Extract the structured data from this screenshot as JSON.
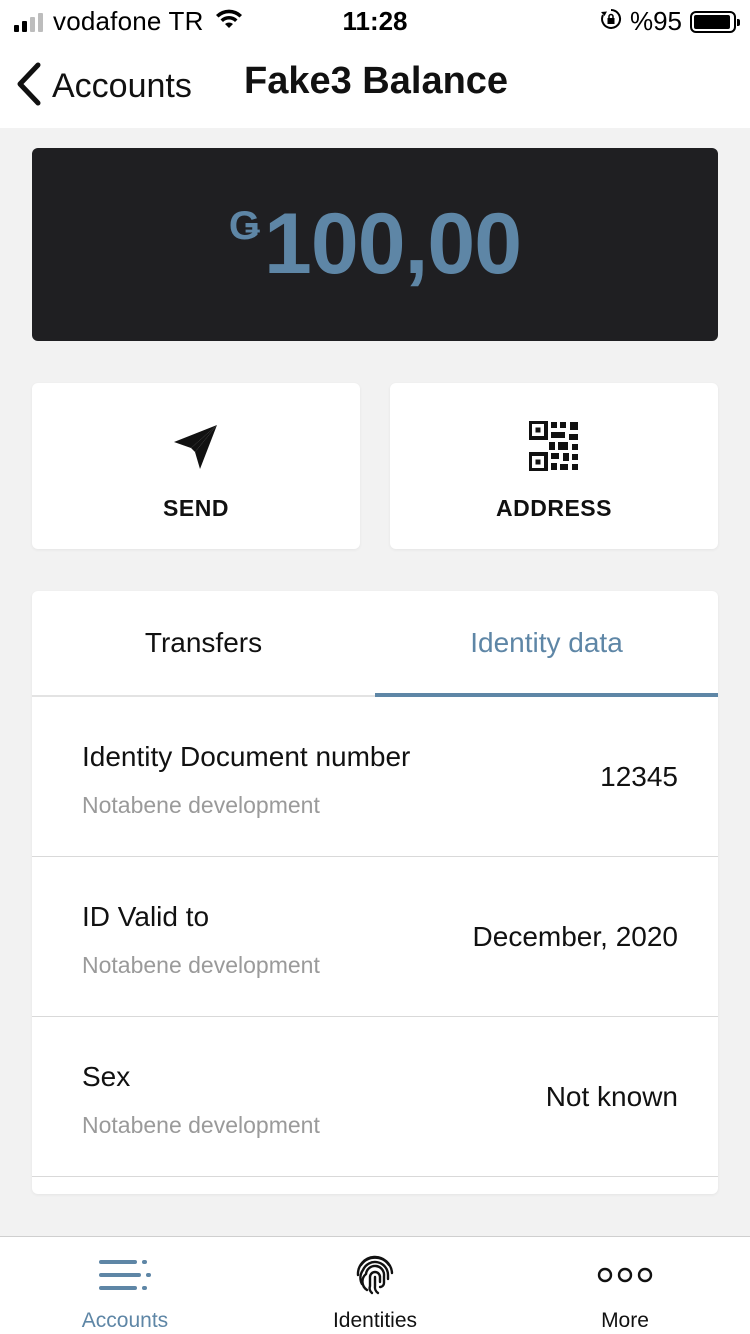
{
  "status_bar": {
    "carrier": "vodafone TR",
    "time": "11:28",
    "battery_text": "%95",
    "battery_level": 0.95
  },
  "header": {
    "back_label": "Accounts",
    "title": "Fake3 Balance"
  },
  "balance": {
    "currency_symbol": "Ǥ",
    "amount": "100,00",
    "accent_color": "#5e86a6"
  },
  "actions": [
    {
      "label": "SEND",
      "icon": "send-icon"
    },
    {
      "label": "ADDRESS",
      "icon": "qr-code-icon"
    }
  ],
  "tabs": [
    {
      "label": "Transfers",
      "active": false
    },
    {
      "label": "Identity data",
      "active": true
    }
  ],
  "identity_rows": [
    {
      "label": "Identity Document number",
      "source": "Notabene development",
      "value": "12345"
    },
    {
      "label": "ID Valid to",
      "source": "Notabene development",
      "value": "December, 2020"
    },
    {
      "label": "Sex",
      "source": "Notabene development",
      "value": "Not known"
    }
  ],
  "tab_bar": [
    {
      "label": "Accounts",
      "icon": "accounts-list-icon",
      "active": true
    },
    {
      "label": "Identities",
      "icon": "fingerprint-icon",
      "active": false
    },
    {
      "label": "More",
      "icon": "more-dots-icon",
      "active": false
    }
  ]
}
